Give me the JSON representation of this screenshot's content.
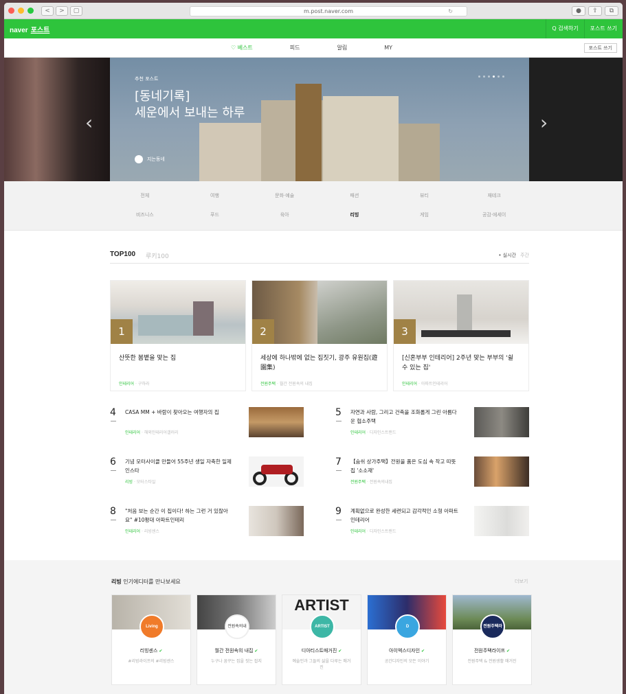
{
  "browser": {
    "url": "m.post.naver.com",
    "back": "<",
    "forward": ">"
  },
  "gnb": {
    "logo": "naver",
    "service": "포스트",
    "my_feed": "Q 검색하기",
    "write": "포스트 쓰기"
  },
  "nav": {
    "tabs": [
      "♡ 베스트",
      "피드",
      "알림",
      "MY"
    ],
    "write_button": "포스트 쓰기"
  },
  "hero": {
    "label": "추천 포스트",
    "title_line1": "[동네기록]",
    "title_line2": "세운에서 보내는 하루",
    "author": "지는동네",
    "prev": "‹",
    "next": "›"
  },
  "categories": {
    "row1": [
      "전체",
      "여행",
      "문화·예술",
      "패션",
      "뷰티",
      "재테크"
    ],
    "row2": [
      "비즈니스",
      "푸드",
      "육아",
      "리빙",
      "게임",
      "공감·에세이"
    ],
    "selected": "리빙"
  },
  "top100": {
    "title": "TOP100",
    "subtitle": "루키100",
    "sort_active": "• 실시간",
    "sort_other": "주간",
    "cards": [
      {
        "rank": "1",
        "title": "산뜻한 봄볕을 맞는 집",
        "source": "인테리어",
        "meta": "· 구하라"
      },
      {
        "rank": "2",
        "title": "세상에 하나밖에 없는 집짓기, 광주 유원집(遊園集)",
        "source": "전원주택",
        "meta": "· 월간 전원속의 내집"
      },
      {
        "rank": "3",
        "title": "[신혼부부 인테리어] 2주년 맞는 부부의 '쉴 수 있는 집'",
        "source": "인테리어",
        "meta": "· 아파트인테리어"
      }
    ],
    "list": [
      {
        "rank": "4",
        "title": "CASA MM + 바람이 찾아오는 여행자의 집",
        "source": "인테리어",
        "meta": "· 해외인테리어갤러리"
      },
      {
        "rank": "5",
        "title": "자연과 사람, 그리고 건축을 조화롭게 그린 아름다운 협소주택",
        "source": "인테리어",
        "meta": "· 디자인스트랜드"
      },
      {
        "rank": "6",
        "title": "기념 모터사이클 만들어 55주년 생일 자축한 일제인스타",
        "source": "리빙",
        "meta": "· 모터스타일"
      },
      {
        "rank": "7",
        "title": "【숨쉬 상가주택】전원을 품은 도심 속 작고 따뜻 집 '소소재'",
        "source": "전원주택",
        "meta": "· 전원속의내집"
      },
      {
        "rank": "8",
        "title": "\"처음 보는 순간 이 집이다! 하는 그런 거 있잖아요\" #10평대 아파트인테리",
        "source": "인테리어",
        "meta": "· 리빙센스"
      },
      {
        "rank": "9",
        "title": "계획없으로 완성한 세련되고 감각적인 소형 아파트 인테리어",
        "source": "인테리어",
        "meta": "· 디자인스트랜드"
      }
    ]
  },
  "editors": {
    "category": "리빙",
    "heading": "인기에디터를 만나보세요",
    "more": "더보기",
    "items": [
      {
        "avatar": "Living Sense",
        "name": "리빙센스",
        "desc": "#리빙라이프의 #리빙센스"
      },
      {
        "avatar": "전원속의내집",
        "name": "월간 전원속의 내집",
        "desc": "누구나 꿈꾸는 집을 짓는 잡지"
      },
      {
        "avatar": "ARTIST",
        "name": "디아티스트매거진",
        "desc": "예술인과 그들의 삶을 다루는 매거진"
      },
      {
        "avatar": "D",
        "name": "아이엑스디자인",
        "desc": "공간디자인의 모든 이야기"
      },
      {
        "avatar": "전원주택라이프",
        "name": "전원주택라이프",
        "desc": "전원주택 & 전원생활 매거진"
      }
    ],
    "artist_banner": "ARTIST"
  }
}
